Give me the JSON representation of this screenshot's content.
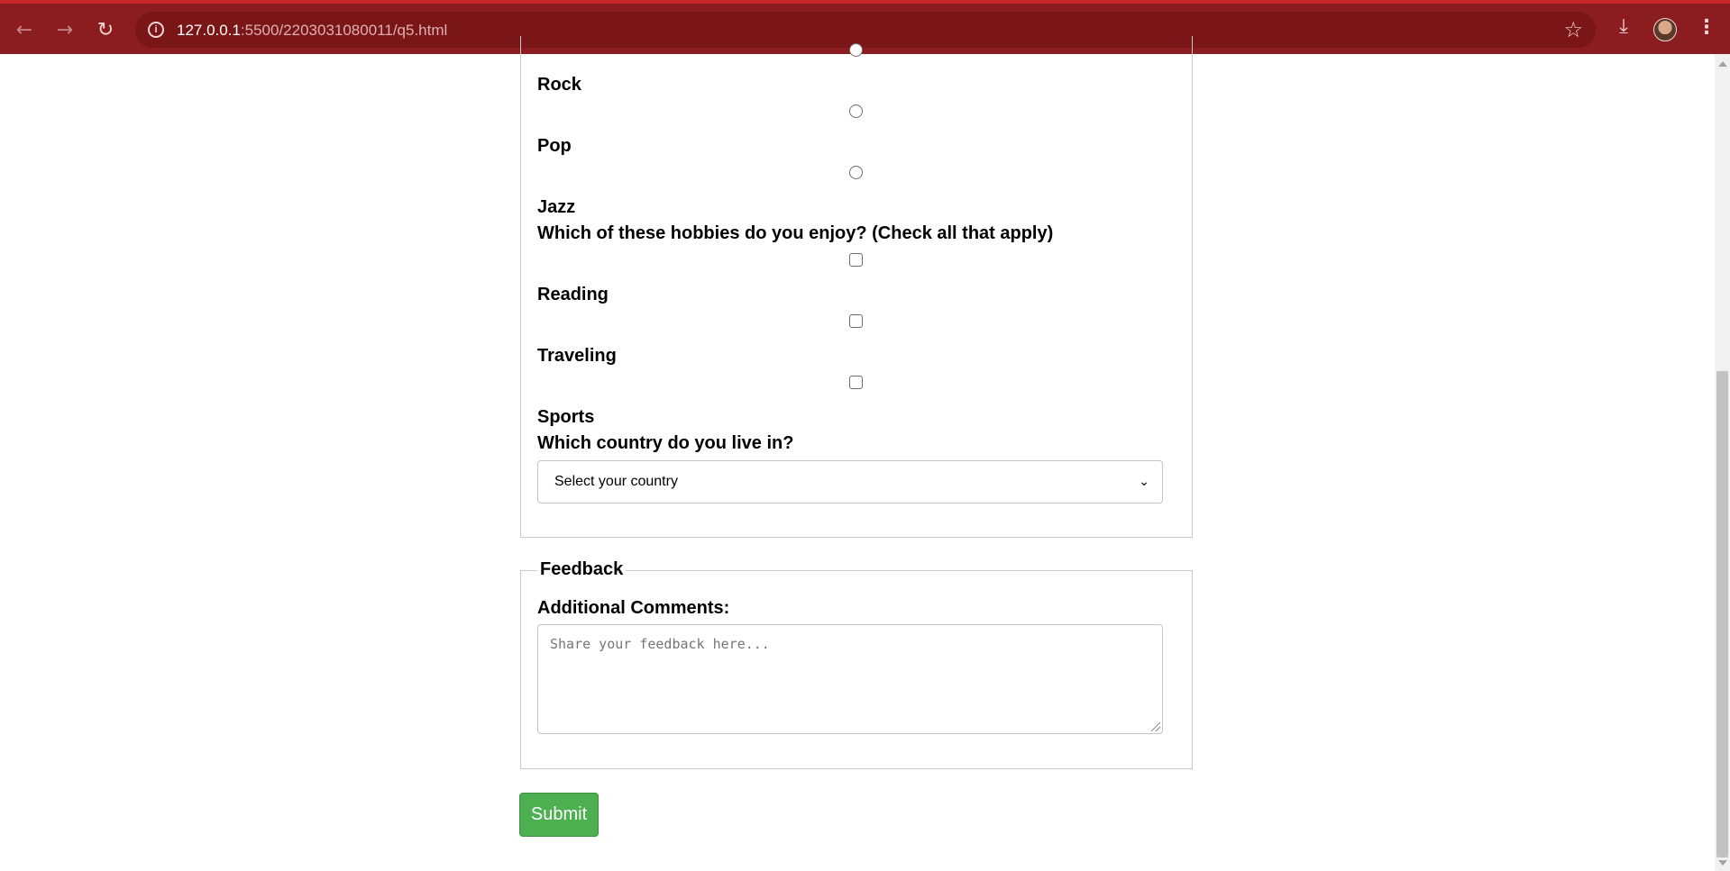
{
  "browser": {
    "url_host": "127.0.0.1",
    "url_path": ":5500/2203031080011/q5.html"
  },
  "music": {
    "options": [
      "Rock",
      "Pop",
      "Jazz"
    ]
  },
  "hobbies": {
    "question": "Which of these hobbies do you enjoy? (Check all that apply)",
    "options": [
      "Reading",
      "Traveling",
      "Sports"
    ]
  },
  "country": {
    "question": "Which country do you live in?",
    "selected": "Select your country"
  },
  "feedback": {
    "legend": "Feedback",
    "comments_label": "Additional Comments:",
    "placeholder": "Share your feedback here..."
  },
  "submit_label": "Submit"
}
